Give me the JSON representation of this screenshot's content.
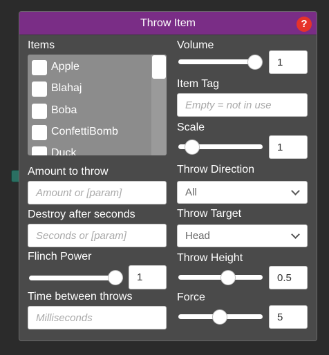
{
  "title": "Throw Item",
  "help_glyph": "?",
  "left": {
    "items_label": "Items",
    "items": [
      "Apple",
      "Blahaj",
      "Boba",
      "ConfettiBomb",
      "Duck"
    ],
    "amount_label": "Amount to throw",
    "amount_placeholder": "Amount or [param]",
    "destroy_label": "Destroy after seconds",
    "destroy_placeholder": "Seconds or [param]",
    "flinch_label": "Flinch Power",
    "flinch_value": "1",
    "flinch_level": 1.0,
    "time_label": "Time between throws",
    "time_placeholder": "Milliseconds"
  },
  "right": {
    "volume_label": "Volume",
    "volume_value": "1",
    "volume_level": 1.0,
    "tag_label": "Item Tag",
    "tag_placeholder": "Empty = not in use",
    "scale_label": "Scale",
    "scale_value": "1",
    "scale_level": 0.1,
    "direction_label": "Throw Direction",
    "direction_value": "All",
    "target_label": "Throw Target",
    "target_value": "Head",
    "height_label": "Throw Height",
    "height_value": "0.5",
    "height_level": 0.6,
    "force_label": "Force",
    "force_value": "5",
    "force_level": 0.5
  },
  "colors": {
    "title_bar": "#7a2d86",
    "panel_bg": "#4a4a4a",
    "help_icon": "#e6322a",
    "connector": "#2a6f62"
  }
}
